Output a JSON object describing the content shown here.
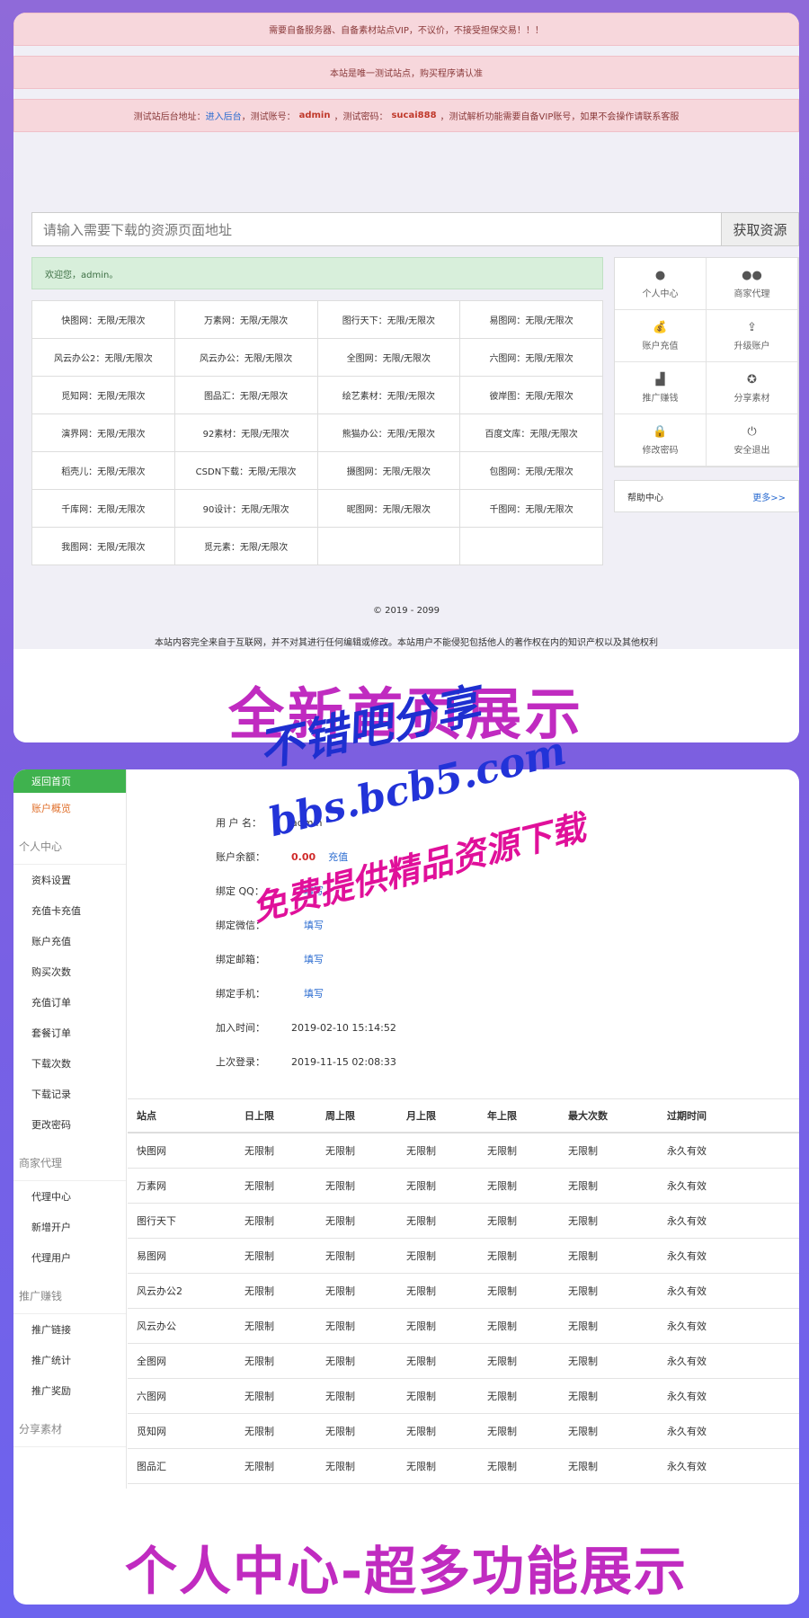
{
  "home": {
    "alerts": {
      "line1": "需要自备服务器、自备素材站点VIP，不议价，不接受担保交易！！！",
      "line2": "本站是唯一测试站点，购买程序请认准",
      "line3_prefix": "测试站后台地址：",
      "line3_link": "进入后台",
      "line3_user_label": "，测试账号：",
      "line3_user": "admin",
      "line3_pwd_label": "，测试密码：",
      "line3_pwd": "sucai888",
      "line3_suffix": "，测试解析功能需要自备VIP账号，如果不会操作请联系客服"
    },
    "search": {
      "placeholder": "请输入需要下载的资源页面地址",
      "button": "获取资源"
    },
    "welcome": "欢迎您，admin。",
    "sites": [
      "快图网：无限/无限次",
      "万素网：无限/无限次",
      "图行天下：无限/无限次",
      "易图网：无限/无限次",
      "风云办公2：无限/无限次",
      "风云办公：无限/无限次",
      "全图网：无限/无限次",
      "六图网：无限/无限次",
      "觅知网：无限/无限次",
      "图品汇：无限/无限次",
      "绘艺素材：无限/无限次",
      "彼岸图：无限/无限次",
      "演界网：无限/无限次",
      "92素材：无限/无限次",
      "熊猫办公：无限/无限次",
      "百度文库：无限/无限次",
      "稻壳儿：无限/无限次",
      "CSDN下载：无限/无限次",
      "摄图网：无限/无限次",
      "包图网：无限/无限次",
      "千库网：无限/无限次",
      "90设计：无限/无限次",
      "昵图网：无限/无限次",
      "千图网：无限/无限次",
      "我图网：无限/无限次",
      "觅元素：无限/无限次",
      "",
      ""
    ],
    "panel": {
      "user_center": "个人中心",
      "merchant": "商家代理",
      "recharge": "账户充值",
      "upgrade": "升级账户",
      "promote": "推广赚钱",
      "share": "分享素材",
      "change_pwd": "修改密码",
      "logout": "安全退出",
      "icons": [
        "user-icon",
        "users-icon",
        "money-bag-icon",
        "upload-icon",
        "chart-icon",
        "share-icon",
        "lock-icon",
        "power-icon"
      ]
    },
    "help": {
      "title": "帮助中心",
      "more": "更多>>"
    },
    "footer": {
      "copyright": "© 2019 - 2099",
      "disclaimer": "本站内容完全来自于互联网，并不对其进行任何编辑或修改。本站用户不能侵犯包括他人的著作权在内的知识产权以及其他权利"
    },
    "banner": "全新首页展示"
  },
  "watermark": {
    "line1": "不错吧分享",
    "line2": "bbs.bcb5.com",
    "line3": "免费提供精品资源下载"
  },
  "profile": {
    "sidebar": {
      "back": "返回首页",
      "overview": "账户概览",
      "groups": [
        {
          "title": "个人中心",
          "items": [
            "资料设置",
            "充值卡充值",
            "账户充值",
            "购买次数",
            "充值订单",
            "套餐订单",
            "下载次数",
            "下载记录",
            "更改密码"
          ]
        },
        {
          "title": "商家代理",
          "items": [
            "代理中心",
            "新增开户",
            "代理用户"
          ]
        },
        {
          "title": "推广赚钱",
          "items": [
            "推广链接",
            "推广统计",
            "推广奖励"
          ]
        },
        {
          "title": "分享素材",
          "items": []
        }
      ]
    },
    "info": {
      "username_label": "用 户 名：",
      "username": "admin",
      "balance_label": "账户余额：",
      "balance": "0.00",
      "recharge": "充值",
      "qq_label": "绑定 QQ：",
      "qq_action": "填写",
      "wechat_label": "绑定微信：",
      "wechat_action": "填写",
      "email_label": "绑定邮箱：",
      "email_action": "填写",
      "phone_label": "绑定手机：",
      "phone_action": "填写",
      "joined_label": "加入时间：",
      "joined": "2019-02-10 15:14:52",
      "last_login_label": "上次登录：",
      "last_login": "2019-11-15 02:08:33"
    },
    "table": {
      "headers": [
        "站点",
        "日上限",
        "周上限",
        "月上限",
        "年上限",
        "最大次数",
        "过期时间"
      ],
      "rows": [
        [
          "快图网",
          "无限制",
          "无限制",
          "无限制",
          "无限制",
          "无限制",
          "永久有效"
        ],
        [
          "万素网",
          "无限制",
          "无限制",
          "无限制",
          "无限制",
          "无限制",
          "永久有效"
        ],
        [
          "图行天下",
          "无限制",
          "无限制",
          "无限制",
          "无限制",
          "无限制",
          "永久有效"
        ],
        [
          "易图网",
          "无限制",
          "无限制",
          "无限制",
          "无限制",
          "无限制",
          "永久有效"
        ],
        [
          "风云办公2",
          "无限制",
          "无限制",
          "无限制",
          "无限制",
          "无限制",
          "永久有效"
        ],
        [
          "风云办公",
          "无限制",
          "无限制",
          "无限制",
          "无限制",
          "无限制",
          "永久有效"
        ],
        [
          "全图网",
          "无限制",
          "无限制",
          "无限制",
          "无限制",
          "无限制",
          "永久有效"
        ],
        [
          "六图网",
          "无限制",
          "无限制",
          "无限制",
          "无限制",
          "无限制",
          "永久有效"
        ],
        [
          "觅知网",
          "无限制",
          "无限制",
          "无限制",
          "无限制",
          "无限制",
          "永久有效"
        ],
        [
          "图品汇",
          "无限制",
          "无限制",
          "无限制",
          "无限制",
          "无限制",
          "永久有效"
        ]
      ]
    },
    "banner": "个人中心-超多功能展示"
  }
}
